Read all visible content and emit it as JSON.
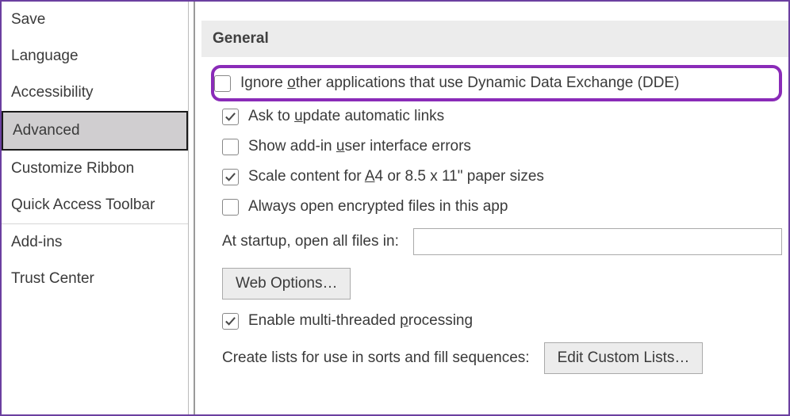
{
  "sidebar": {
    "items": [
      {
        "label": "Save"
      },
      {
        "label": "Language"
      },
      {
        "label": "Accessibility"
      },
      {
        "label": "Advanced",
        "selected": true
      },
      {
        "label": "Customize Ribbon"
      },
      {
        "label": "Quick Access Toolbar"
      },
      {
        "label": "Add-ins"
      },
      {
        "label": "Trust Center"
      }
    ]
  },
  "section": {
    "title": "General"
  },
  "options": {
    "dde": {
      "checked": false,
      "pre": "Ignore ",
      "mn": "o",
      "post": "ther applications that use Dynamic Data Exchange (DDE)"
    },
    "update_links": {
      "checked": true,
      "pre": "Ask to ",
      "mn": "u",
      "post": "pdate automatic links"
    },
    "addin_errors": {
      "checked": false,
      "pre": "Show add-in ",
      "mn": "u",
      "post": "ser interface errors"
    },
    "scale_a4": {
      "checked": true,
      "pre": "Scale content for ",
      "mn": "A",
      "post": "4 or 8.5 x 11\" paper sizes"
    },
    "encrypted": {
      "checked": false,
      "pre": "Always open encrypted files in this app",
      "mn": "",
      "post": ""
    },
    "multithread": {
      "checked": true,
      "pre": "Enable multi-threaded ",
      "mn": "p",
      "post": "rocessing"
    }
  },
  "startup": {
    "label": "At startup, open all files in:",
    "value": ""
  },
  "buttons": {
    "web_options": "Web Options…",
    "edit_custom_lists": "Edit Custom Lists…"
  },
  "lists": {
    "label": "Create lists for use in sorts and fill sequences:"
  }
}
